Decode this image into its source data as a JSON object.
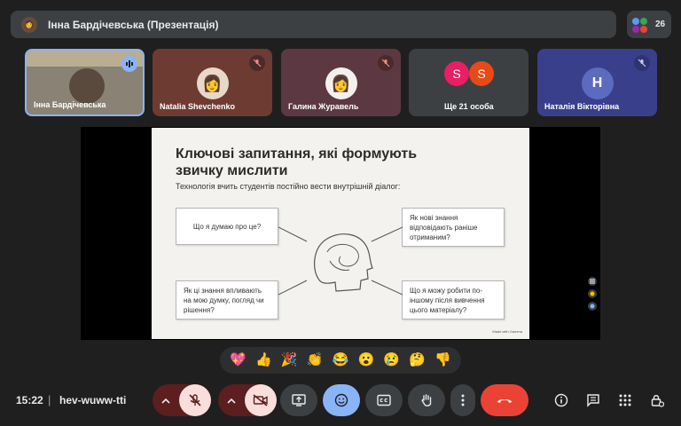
{
  "header": {
    "presenter_title": "Інна Бардічевська (Презентація)",
    "participants_count": "26"
  },
  "tiles": [
    {
      "name": "Інна Бардічевська"
    },
    {
      "name": "Natalia Shevchenko"
    },
    {
      "name": "Галина Журавель"
    },
    {
      "name": "Ще 21 особа",
      "initials": [
        "S",
        "S"
      ]
    },
    {
      "name": "Наталія Вікторівна",
      "initial": "H"
    }
  ],
  "slide": {
    "heading": "Ключові запитання, які формують звичку мислити",
    "subtitle": "Технологія вчить студентів постійно вести внутрішній діалог:",
    "questions": [
      "Що я думаю про це?",
      "Як нові знання відповідають раніше отриманим?",
      "Як ці знання впливають на мою думку, погляд чи рішення?",
      "Що я можу робити по-іншому після вивчення цього матеріалу?"
    ],
    "footer": "Made with Gamma"
  },
  "reactions": [
    "💖",
    "👍",
    "🎉",
    "👏",
    "😂",
    "😮",
    "😢",
    "🤔",
    "👎"
  ],
  "bottom": {
    "time": "15:22",
    "separator": "|",
    "meeting_code": "hev-wuww-tti"
  },
  "colors": {
    "accent_blue": "#8ab4f8",
    "danger_red": "#ea4335",
    "muted_red_bg": "#f9dedc"
  },
  "icons": [
    "presenter-avatar-icon",
    "mic-off-icon",
    "camera-off-icon",
    "present-screen-icon",
    "emoji-icon",
    "captions-icon",
    "raise-hand-icon",
    "more-options-icon",
    "end-call-icon",
    "info-icon",
    "chat-icon",
    "activities-icon",
    "host-controls-icon"
  ]
}
